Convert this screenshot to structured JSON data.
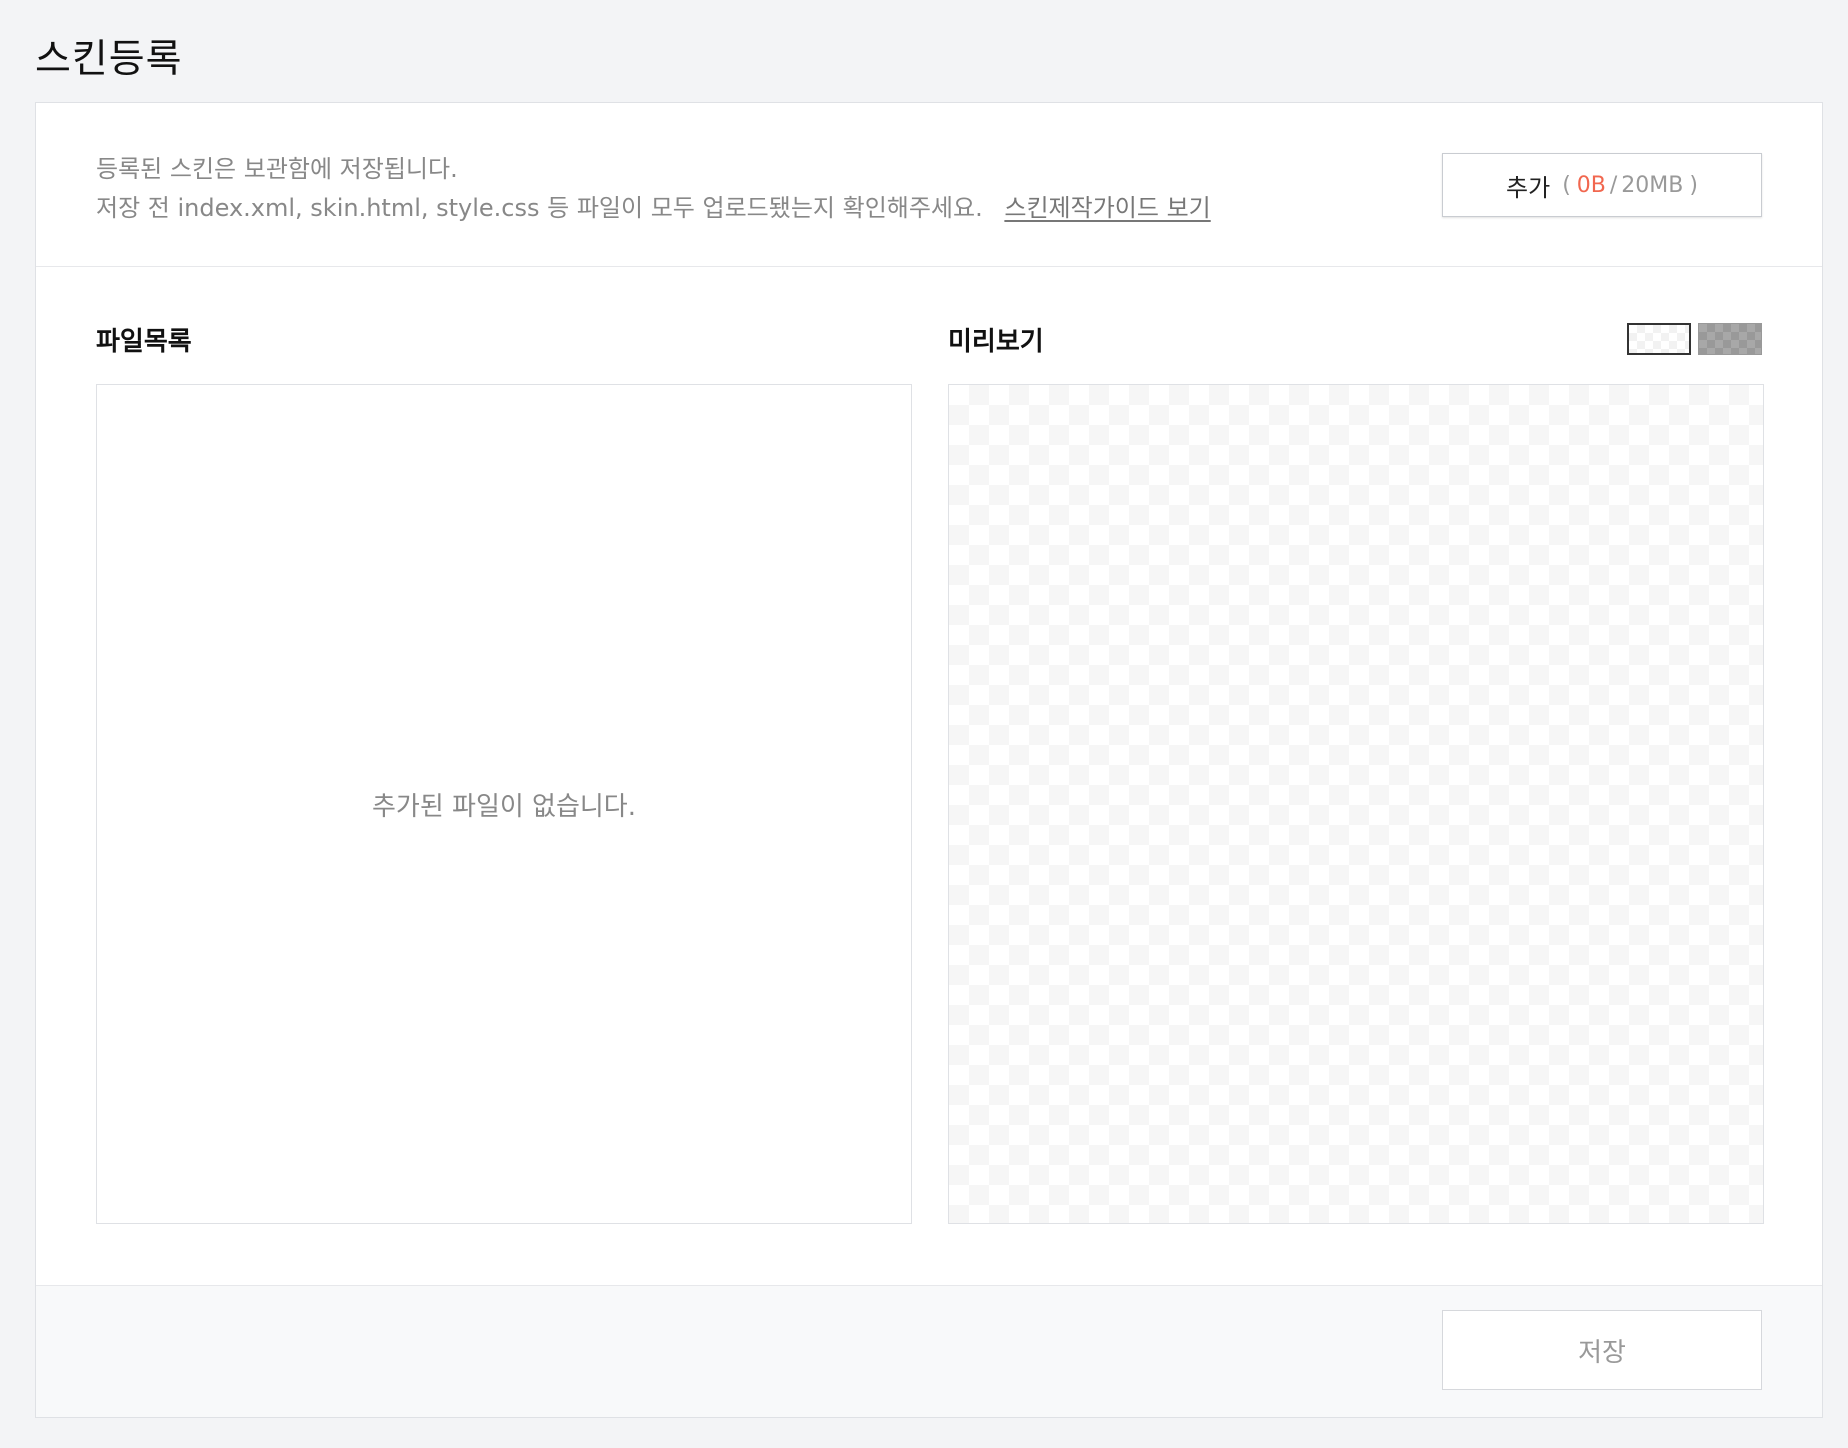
{
  "page": {
    "title": "스킨등록"
  },
  "info": {
    "line1": "등록된 스킨은 보관함에 저장됩니다.",
    "line2": "저장 전 index.xml, skin.html, style.css 등 파일이 모두 업로드됐는지 확인해주세요.",
    "guide_link": "스킨제작가이드 보기"
  },
  "add_button": {
    "label": "추가",
    "open_paren": "(",
    "used": "0B",
    "separator": "/",
    "limit": "20MB",
    "close_paren": ")",
    "used_color": "#f1674f"
  },
  "file_list": {
    "title": "파일목록",
    "empty_message": "추가된 파일이 없습니다."
  },
  "preview": {
    "title": "미리보기",
    "bg_options": [
      "light-checker",
      "dark-checker"
    ],
    "selected_bg": "light-checker"
  },
  "footer": {
    "save_label": "저장"
  }
}
